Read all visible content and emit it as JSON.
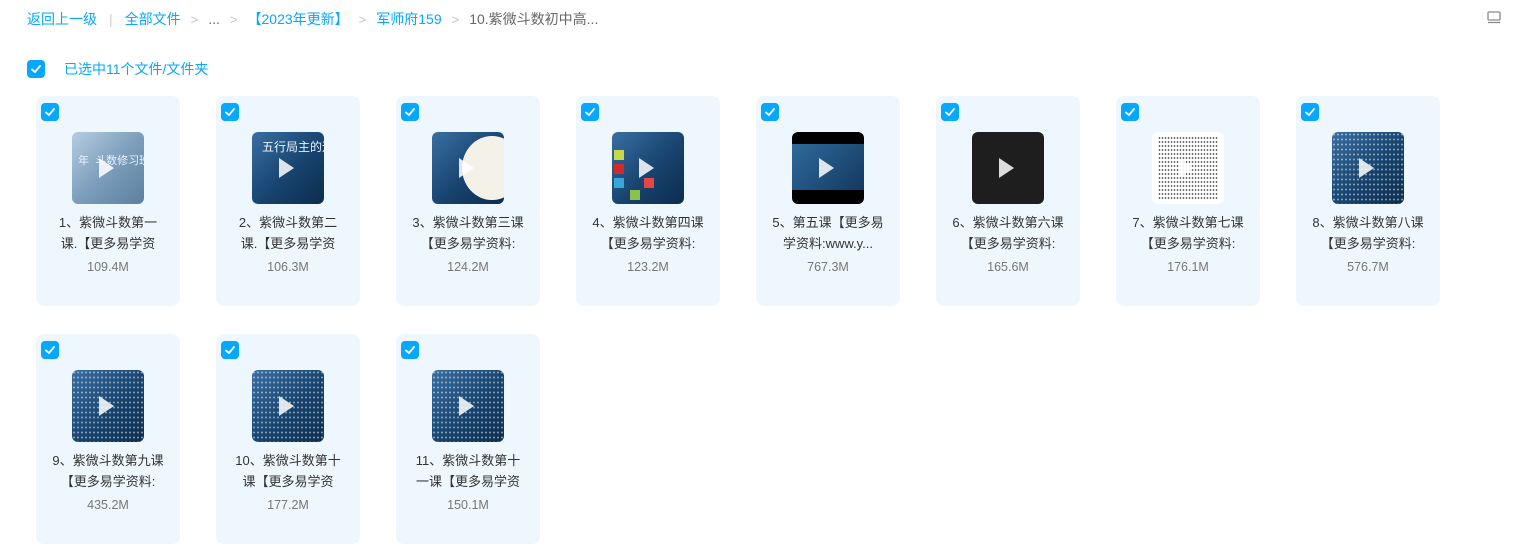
{
  "breadcrumb": {
    "back": "返回上一级",
    "all_files": "全部文件",
    "ellipsis": "...",
    "folder1": "【2023年更新】",
    "folder2": "军师府159",
    "current": "10.紫微斗数初中高..."
  },
  "selection": {
    "label": "已选中11个文件/文件夹"
  },
  "files": [
    {
      "line1": "1、紫微斗数第一",
      "line2": "课.【更多易学资",
      "size": "109.4M"
    },
    {
      "line1": "2、紫微斗数第二",
      "line2": "课.【更多易学资",
      "size": "106.3M"
    },
    {
      "line1": "3、紫微斗数第三课",
      "line2": "【更多易学资料:",
      "size": "124.2M"
    },
    {
      "line1": "4、紫微斗数第四课",
      "line2": "【更多易学资料:",
      "size": "123.2M"
    },
    {
      "line1": "5、第五课【更多易",
      "line2": "学资料:www.y...",
      "size": "767.3M"
    },
    {
      "line1": "6、紫微斗数第六课",
      "line2": "【更多易学资料:",
      "size": "165.6M"
    },
    {
      "line1": "7、紫微斗数第七课",
      "line2": "【更多易学资料:",
      "size": "176.1M"
    },
    {
      "line1": "8、紫微斗数第八课",
      "line2": "【更多易学资料:",
      "size": "576.7M"
    },
    {
      "line1": "9、紫微斗数第九课",
      "line2": "【更多易学资料:",
      "size": "435.2M"
    },
    {
      "line1": "10、紫微斗数第十",
      "line2": "课【更多易学资",
      "size": "177.2M"
    },
    {
      "line1": "11、紫微斗数第十",
      "line2": "一课【更多易学资",
      "size": "150.1M"
    }
  ],
  "thumbnail_text": {
    "thumb1": "年  斗数修习班",
    "thumb2": "五行局主的运"
  },
  "colors": {
    "accent": "#06a7ff",
    "card_bg": "#eef7fe"
  }
}
